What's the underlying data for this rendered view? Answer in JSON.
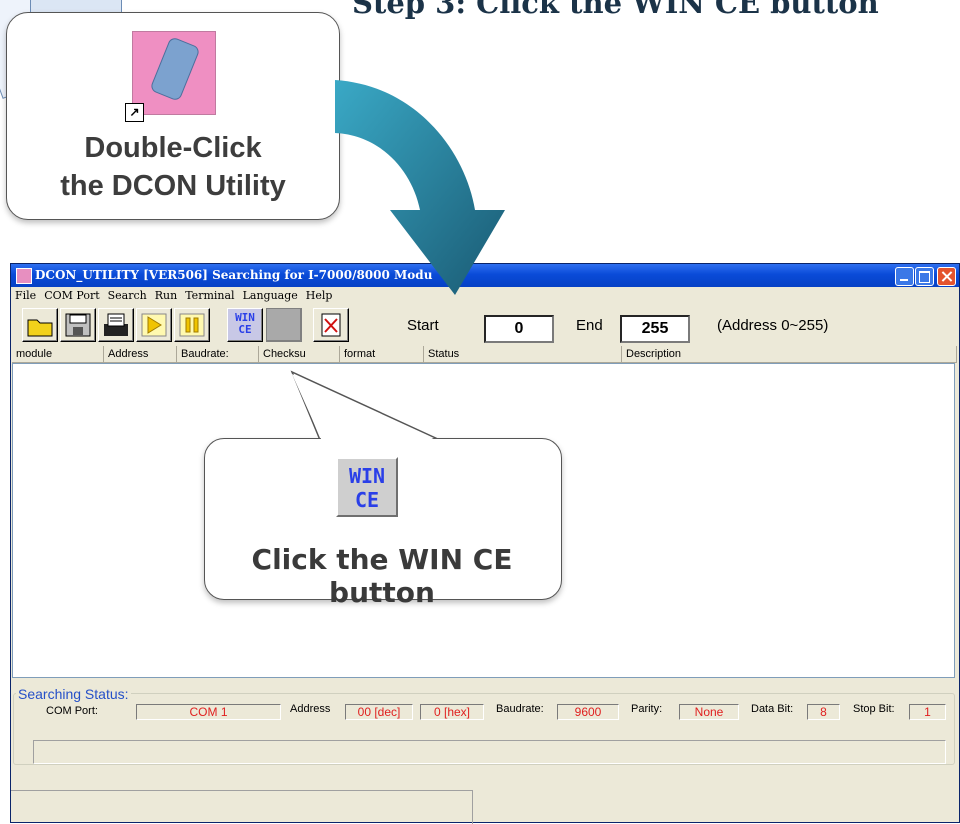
{
  "heading": "Step 3: Click the WIN CE button",
  "callout_top": {
    "line1": "Double-Click",
    "line2": "the DCON Utility"
  },
  "window": {
    "title": "DCON_UTILITY [VER506] Searching for I-7000/8000 Modu",
    "menu": [
      "File",
      "COM Port",
      "Search",
      "Run",
      "Terminal",
      "Language",
      "Help"
    ],
    "toolbar": {
      "wince_line1": "WIN",
      "wince_line2": "CE",
      "start_label": "Start",
      "start_value": "0",
      "end_label": "End",
      "end_value": "255",
      "range_note": "(Address 0~255)"
    },
    "columns": [
      "module",
      "Address",
      "Baudrate:",
      "Checksu",
      "format",
      "Status",
      "Description"
    ],
    "status": {
      "group_title": "Searching Status:",
      "com_label": "COM Port:",
      "com_value": "COM 1",
      "address_label": "Address",
      "address_dec": "00 [dec]",
      "address_hex": "0 [hex]",
      "baud_label": "Baudrate:",
      "baud_value": "9600",
      "parity_label": "Parity:",
      "parity_value": "None",
      "databit_label": "Data Bit:",
      "databit_value": "8",
      "stopbit_label": "Stop Bit:",
      "stopbit_value": "1"
    }
  },
  "callout_bottom": {
    "icon_line1": "WIN",
    "icon_line2": "CE",
    "text": "Click the WIN CE button"
  },
  "colors": {
    "arrow_top": "#3aa9c6",
    "arrow_bottom": "#1a5a73",
    "titlebar": "#0a4bd8",
    "status_text": "#e02020"
  }
}
